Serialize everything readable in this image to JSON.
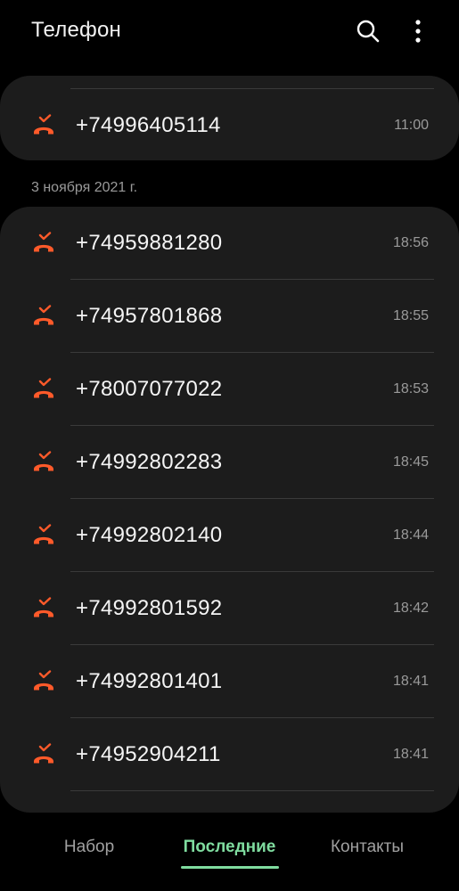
{
  "app": {
    "title": "Телефон"
  },
  "icons": {
    "search": "search-icon",
    "more": "more-vertical-icon",
    "call": "missed-call-icon"
  },
  "colors": {
    "missed_call": "#ff5a2a",
    "active_tab": "#7fdc9f",
    "card_background": "#1c1c1c",
    "time_text": "#9a9a9a"
  },
  "groups": [
    {
      "header": "",
      "calls": [
        {
          "number": "+74996405114",
          "time": "11:00"
        }
      ]
    },
    {
      "header": "3 ноября 2021 г.",
      "calls": [
        {
          "number": "+74959881280",
          "time": "18:56"
        },
        {
          "number": "+74957801868",
          "time": "18:55"
        },
        {
          "number": "+78007077022",
          "time": "18:53"
        },
        {
          "number": "+74992802283",
          "time": "18:45"
        },
        {
          "number": "+74992802140",
          "time": "18:44"
        },
        {
          "number": "+74992801592",
          "time": "18:42"
        },
        {
          "number": "+74992801401",
          "time": "18:41"
        },
        {
          "number": "+74952904211",
          "time": "18:41"
        }
      ]
    }
  ],
  "bottom_nav": {
    "tabs": [
      {
        "label": "Набор",
        "active": false
      },
      {
        "label": "Последние",
        "active": true
      },
      {
        "label": "Контакты",
        "active": false
      }
    ]
  }
}
